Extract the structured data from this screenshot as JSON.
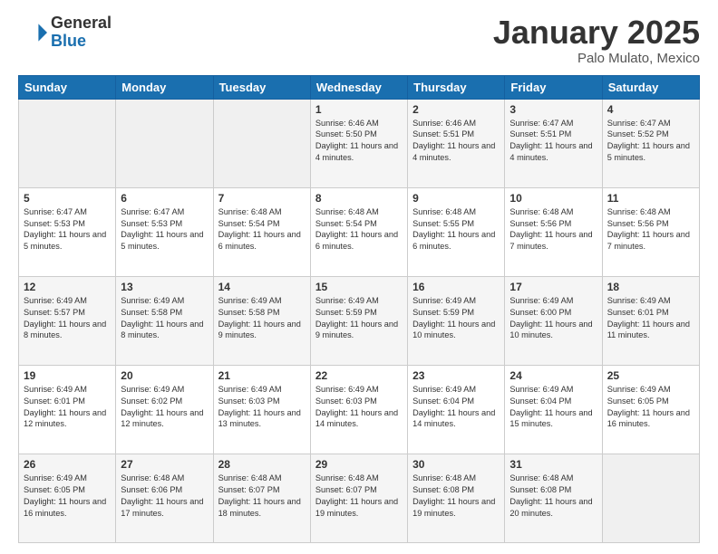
{
  "header": {
    "logo_general": "General",
    "logo_blue": "Blue",
    "month_title": "January 2025",
    "location": "Palo Mulato, Mexico"
  },
  "days_of_week": [
    "Sunday",
    "Monday",
    "Tuesday",
    "Wednesday",
    "Thursday",
    "Friday",
    "Saturday"
  ],
  "weeks": [
    [
      {
        "day": "",
        "info": ""
      },
      {
        "day": "",
        "info": ""
      },
      {
        "day": "",
        "info": ""
      },
      {
        "day": "1",
        "info": "Sunrise: 6:46 AM\nSunset: 5:50 PM\nDaylight: 11 hours and 4 minutes."
      },
      {
        "day": "2",
        "info": "Sunrise: 6:46 AM\nSunset: 5:51 PM\nDaylight: 11 hours and 4 minutes."
      },
      {
        "day": "3",
        "info": "Sunrise: 6:47 AM\nSunset: 5:51 PM\nDaylight: 11 hours and 4 minutes."
      },
      {
        "day": "4",
        "info": "Sunrise: 6:47 AM\nSunset: 5:52 PM\nDaylight: 11 hours and 5 minutes."
      }
    ],
    [
      {
        "day": "5",
        "info": "Sunrise: 6:47 AM\nSunset: 5:53 PM\nDaylight: 11 hours and 5 minutes."
      },
      {
        "day": "6",
        "info": "Sunrise: 6:47 AM\nSunset: 5:53 PM\nDaylight: 11 hours and 5 minutes."
      },
      {
        "day": "7",
        "info": "Sunrise: 6:48 AM\nSunset: 5:54 PM\nDaylight: 11 hours and 6 minutes."
      },
      {
        "day": "8",
        "info": "Sunrise: 6:48 AM\nSunset: 5:54 PM\nDaylight: 11 hours and 6 minutes."
      },
      {
        "day": "9",
        "info": "Sunrise: 6:48 AM\nSunset: 5:55 PM\nDaylight: 11 hours and 6 minutes."
      },
      {
        "day": "10",
        "info": "Sunrise: 6:48 AM\nSunset: 5:56 PM\nDaylight: 11 hours and 7 minutes."
      },
      {
        "day": "11",
        "info": "Sunrise: 6:48 AM\nSunset: 5:56 PM\nDaylight: 11 hours and 7 minutes."
      }
    ],
    [
      {
        "day": "12",
        "info": "Sunrise: 6:49 AM\nSunset: 5:57 PM\nDaylight: 11 hours and 8 minutes."
      },
      {
        "day": "13",
        "info": "Sunrise: 6:49 AM\nSunset: 5:58 PM\nDaylight: 11 hours and 8 minutes."
      },
      {
        "day": "14",
        "info": "Sunrise: 6:49 AM\nSunset: 5:58 PM\nDaylight: 11 hours and 9 minutes."
      },
      {
        "day": "15",
        "info": "Sunrise: 6:49 AM\nSunset: 5:59 PM\nDaylight: 11 hours and 9 minutes."
      },
      {
        "day": "16",
        "info": "Sunrise: 6:49 AM\nSunset: 5:59 PM\nDaylight: 11 hours and 10 minutes."
      },
      {
        "day": "17",
        "info": "Sunrise: 6:49 AM\nSunset: 6:00 PM\nDaylight: 11 hours and 10 minutes."
      },
      {
        "day": "18",
        "info": "Sunrise: 6:49 AM\nSunset: 6:01 PM\nDaylight: 11 hours and 11 minutes."
      }
    ],
    [
      {
        "day": "19",
        "info": "Sunrise: 6:49 AM\nSunset: 6:01 PM\nDaylight: 11 hours and 12 minutes."
      },
      {
        "day": "20",
        "info": "Sunrise: 6:49 AM\nSunset: 6:02 PM\nDaylight: 11 hours and 12 minutes."
      },
      {
        "day": "21",
        "info": "Sunrise: 6:49 AM\nSunset: 6:03 PM\nDaylight: 11 hours and 13 minutes."
      },
      {
        "day": "22",
        "info": "Sunrise: 6:49 AM\nSunset: 6:03 PM\nDaylight: 11 hours and 14 minutes."
      },
      {
        "day": "23",
        "info": "Sunrise: 6:49 AM\nSunset: 6:04 PM\nDaylight: 11 hours and 14 minutes."
      },
      {
        "day": "24",
        "info": "Sunrise: 6:49 AM\nSunset: 6:04 PM\nDaylight: 11 hours and 15 minutes."
      },
      {
        "day": "25",
        "info": "Sunrise: 6:49 AM\nSunset: 6:05 PM\nDaylight: 11 hours and 16 minutes."
      }
    ],
    [
      {
        "day": "26",
        "info": "Sunrise: 6:49 AM\nSunset: 6:05 PM\nDaylight: 11 hours and 16 minutes."
      },
      {
        "day": "27",
        "info": "Sunrise: 6:48 AM\nSunset: 6:06 PM\nDaylight: 11 hours and 17 minutes."
      },
      {
        "day": "28",
        "info": "Sunrise: 6:48 AM\nSunset: 6:07 PM\nDaylight: 11 hours and 18 minutes."
      },
      {
        "day": "29",
        "info": "Sunrise: 6:48 AM\nSunset: 6:07 PM\nDaylight: 11 hours and 19 minutes."
      },
      {
        "day": "30",
        "info": "Sunrise: 6:48 AM\nSunset: 6:08 PM\nDaylight: 11 hours and 19 minutes."
      },
      {
        "day": "31",
        "info": "Sunrise: 6:48 AM\nSunset: 6:08 PM\nDaylight: 11 hours and 20 minutes."
      },
      {
        "day": "",
        "info": ""
      }
    ]
  ]
}
